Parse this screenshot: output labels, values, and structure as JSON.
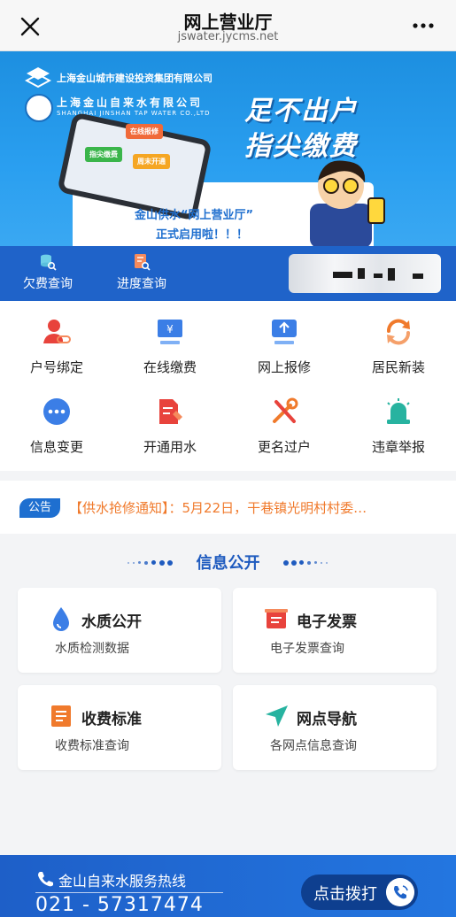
{
  "topbar": {
    "title": "网上营业厅",
    "domain": "jswater.jycms.net"
  },
  "banner": {
    "company1": "上海金山城市建设投资集团有限公司",
    "company2": "上海金山自来水有限公司",
    "company2_en": "SHANGHAI JINSHAN TAP WATER CO.,LTD",
    "slogan1": "足不出户",
    "slogan2": "指尖缴费",
    "launch1": "金山供水“网上营业厅”",
    "launch2": "正式启用啦！！！",
    "tags": [
      "在线报修",
      "指尖缴费",
      "周末开通"
    ]
  },
  "quickbar": {
    "items": [
      {
        "label": "欠费查询",
        "icon": "database-search-icon"
      },
      {
        "label": "进度查询",
        "icon": "document-search-icon"
      }
    ]
  },
  "services": [
    {
      "label": "户号绑定",
      "icon": "user-link-icon",
      "color": "#e8433c"
    },
    {
      "label": "在线缴费",
      "icon": "yuan-monitor-icon",
      "color": "#3b7ee6"
    },
    {
      "label": "网上报修",
      "icon": "upload-monitor-icon",
      "color": "#3b7ee6"
    },
    {
      "label": "居民新装",
      "icon": "refresh-icon",
      "color": "#f07a2c"
    },
    {
      "label": "信息变更",
      "icon": "more-dots-icon",
      "color": "#3b7ee6"
    },
    {
      "label": "开通用水",
      "icon": "edit-document-icon",
      "color": "#e8433c"
    },
    {
      "label": "更名过户",
      "icon": "tools-icon",
      "color": "#f07a2c"
    },
    {
      "label": "违章举报",
      "icon": "alarm-icon",
      "color": "#27b3a0"
    }
  ],
  "notice": {
    "tag": "公告",
    "text": "【供水抢修通知】：5月22日，干巷镇光明村村委…"
  },
  "info_section": {
    "title": "信息公开",
    "cards": [
      {
        "title": "水质公开",
        "subtitle": "水质检测数据",
        "icon": "water-drop-icon",
        "color": "#3b7ee6"
      },
      {
        "title": "电子发票",
        "subtitle": "电子发票查询",
        "icon": "invoice-icon",
        "color": "#e8433c"
      },
      {
        "title": "收费标准",
        "subtitle": "收费标准查询",
        "icon": "list-document-icon",
        "color": "#f07a2c"
      },
      {
        "title": "网点导航",
        "subtitle": "各网点信息查询",
        "icon": "navigation-arrow-icon",
        "color": "#27b3a0"
      }
    ]
  },
  "hotline": {
    "title": "金山自来水服务热线",
    "number": "021 - 57317474",
    "call_label": "点击拨打"
  },
  "colors": {
    "primary_blue": "#1f63c9",
    "accent_orange": "#f07a2c",
    "accent_red": "#e8433c",
    "accent_teal": "#27b3a0"
  }
}
